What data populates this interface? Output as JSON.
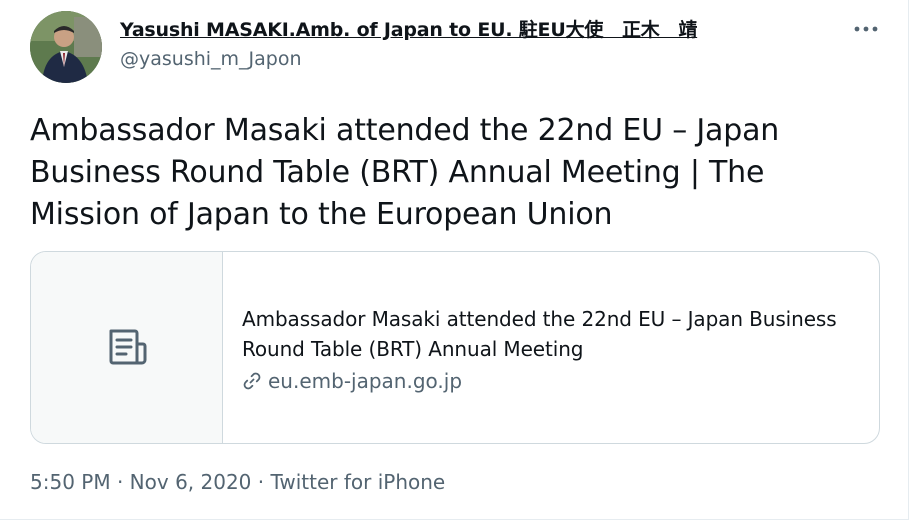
{
  "author": {
    "display_name": "Yasushi MASAKI.Amb. of Japan to EU. 駐EU大使　正木　靖",
    "handle": "@yasushi_m_Japon"
  },
  "tweet": {
    "text": "Ambassador Masaki attended the 22nd EU – Japan Business Round Table (BRT) Annual Meeting | The Mission of Japan to the European Union"
  },
  "card": {
    "thumbnail_icon": "document-icon",
    "title": "Ambassador Masaki attended the 22nd EU – Japan Business Round Table (BRT) Annual Meeting",
    "domain": "eu.emb-japan.go.jp",
    "domain_icon": "link-icon"
  },
  "meta": {
    "time": "5:50 PM",
    "separator": " · ",
    "date": "Nov 6, 2020",
    "source": "Twitter for iPhone"
  },
  "colors": {
    "primary_text": "#0f1419",
    "secondary_text": "#536471",
    "border": "#cfd9de",
    "card_thumb_bg": "#f7f9f9"
  }
}
